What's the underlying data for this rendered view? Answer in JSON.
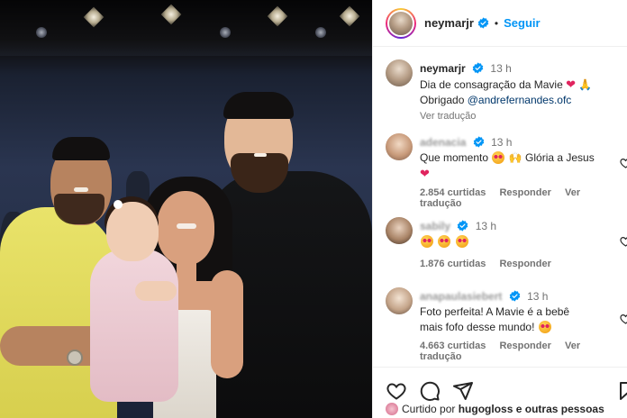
{
  "header": {
    "username": "neymarjr",
    "separator": "•",
    "follow_label": "Seguir"
  },
  "caption": {
    "username": "neymarjr",
    "time": "13 h",
    "text_line1": "Dia de consagração da Mavie",
    "text_line2_prefix": "Obrigado",
    "mention": "@andrefernandes.ofc",
    "translate_label": "Ver tradução"
  },
  "comments": [
    {
      "username": "adenacia",
      "time": "13 h",
      "text": "Que momento",
      "text_after": "Glória a Jesus",
      "likes": "2.854 curtidas",
      "reply_label": "Responder",
      "translate_label": "Ver tradução"
    },
    {
      "username": "sabily",
      "time": "13 h",
      "text": "",
      "likes": "1.876 curtidas",
      "reply_label": "Responder"
    },
    {
      "username": "anapaulasiebert",
      "time": "13 h",
      "text_line1": "Foto perfeita! A Mavie é a bebê",
      "text_line2": "mais fofo desse mundo!",
      "likes": "4.663 curtidas",
      "reply_label": "Responder",
      "translate_label": "Ver tradução"
    }
  ],
  "footer": {
    "liked_prefix": "Curtido por",
    "liked_user": "hugogloss",
    "liked_suffix": "e outras pessoas"
  },
  "colors": {
    "accent_blue": "#0095f6",
    "mention_blue": "#00376b",
    "heart_red": "#e0245e",
    "muted": "#737373"
  },
  "icons": [
    "verified-badge-icon",
    "heart-icon",
    "comment-icon",
    "share-icon",
    "bookmark-icon"
  ]
}
